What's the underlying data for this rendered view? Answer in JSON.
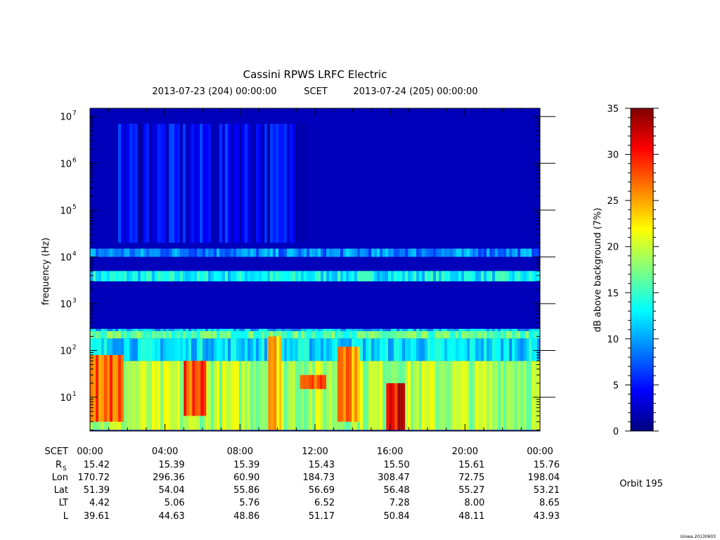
{
  "chart_data": {
    "type": "heatmap",
    "title": "Cassini RPWS LRFC Electric",
    "subtitle": {
      "start": "2013-07-23 (204) 00:00:00",
      "label": "SCET",
      "end": "2013-07-24 (205) 00:00:00"
    },
    "ylabel": "frequency (Hz)",
    "yscale": "log",
    "ylim": [
      1.9,
      15000000
    ],
    "y_ticks": [
      {
        "mantissa": "10",
        "exp": "1",
        "value": 10
      },
      {
        "mantissa": "10",
        "exp": "2",
        "value": 100
      },
      {
        "mantissa": "10",
        "exp": "3",
        "value": 1000
      },
      {
        "mantissa": "10",
        "exp": "4",
        "value": 10000
      },
      {
        "mantissa": "10",
        "exp": "5",
        "value": 100000
      },
      {
        "mantissa": "10",
        "exp": "6",
        "value": 1000000
      },
      {
        "mantissa": "10",
        "exp": "7",
        "value": 10000000
      }
    ],
    "x_hours_range": [
      0,
      24
    ],
    "colorbar": {
      "label": "dB above background (7%)",
      "range": [
        0,
        35
      ],
      "ticks": [
        "0",
        "5",
        "10",
        "15",
        "20",
        "25",
        "30",
        "35"
      ],
      "colors": [
        "#00007f",
        "#0000ff",
        "#007fff",
        "#00ffff",
        "#7fff7f",
        "#ffff00",
        "#ff7f00",
        "#ff0000",
        "#7f0000"
      ]
    },
    "ephemeris": {
      "row_labels": [
        {
          "main": "SCET",
          "sub": ""
        },
        {
          "main": "R",
          "sub": "S"
        },
        {
          "main": "Lon",
          "sub": ""
        },
        {
          "main": "Lat",
          "sub": ""
        },
        {
          "main": "LT",
          "sub": ""
        },
        {
          "main": "L",
          "sub": ""
        }
      ],
      "columns": [
        {
          "hour": 0,
          "values": [
            "00:00",
            "15.42",
            "170.72",
            "51.39",
            "4.42",
            "39.61"
          ]
        },
        {
          "hour": 4,
          "values": [
            "04:00",
            "15.39",
            "296.36",
            "54.04",
            "5.06",
            "44.63"
          ]
        },
        {
          "hour": 8,
          "values": [
            "08:00",
            "15.39",
            "60.90",
            "55.86",
            "5.76",
            "48.86"
          ]
        },
        {
          "hour": 12,
          "values": [
            "12:00",
            "15.43",
            "184.73",
            "56.69",
            "6.52",
            "51.17"
          ]
        },
        {
          "hour": 16,
          "values": [
            "16:00",
            "15.50",
            "308.47",
            "56.48",
            "7.28",
            "50.84"
          ]
        },
        {
          "hour": 20,
          "values": [
            "20:00",
            "15.61",
            "72.75",
            "55.27",
            "8.00",
            "48.11"
          ]
        },
        {
          "hour": 24,
          "values": [
            "00:00",
            "15.76",
            "198.04",
            "53.21",
            "8.65",
            "43.93"
          ]
        }
      ]
    },
    "orbit_label": "Orbit 195",
    "version_label": "Uiowa 20130603",
    "features": [
      {
        "kind": "band",
        "h0": 0,
        "h1": 24,
        "f_lo": 3000,
        "f_hi": 5000,
        "db": 13
      },
      {
        "kind": "band",
        "h0": 0,
        "h1": 24,
        "f_lo": 180,
        "f_hi": 260,
        "db": 16
      },
      {
        "kind": "band",
        "h0": 0,
        "h1": 24,
        "f_lo": 260,
        "f_hi": 290,
        "db": 11
      },
      {
        "kind": "band",
        "h0": 0,
        "h1": 24,
        "f_lo": 10000,
        "f_hi": 15000,
        "db": 9
      },
      {
        "kind": "band",
        "h0": 1.5,
        "h1": 11.5,
        "f_lo": 20000,
        "f_hi": 7000000,
        "db": 4
      },
      {
        "kind": "band",
        "h0": 0,
        "h1": 24,
        "f_lo": 2,
        "f_hi": 60,
        "db": 19
      },
      {
        "kind": "band",
        "h0": 0,
        "h1": 24,
        "f_lo": 60,
        "f_hi": 180,
        "db": 12
      },
      {
        "kind": "band",
        "h0": 0,
        "h1": 1.8,
        "f_lo": 3,
        "f_hi": 80,
        "db": 27
      },
      {
        "kind": "band",
        "h0": 5,
        "h1": 6.2,
        "f_lo": 4,
        "f_hi": 60,
        "db": 28
      },
      {
        "kind": "band",
        "h0": 13.2,
        "h1": 14.4,
        "f_lo": 3,
        "f_hi": 120,
        "db": 26
      },
      {
        "kind": "band",
        "h0": 15.8,
        "h1": 16.8,
        "f_lo": 2,
        "f_hi": 20,
        "db": 31
      },
      {
        "kind": "band",
        "h0": 11.2,
        "h1": 12.6,
        "f_lo": 15,
        "f_hi": 30,
        "db": 27
      },
      {
        "kind": "band",
        "h0": 9.5,
        "h1": 10.2,
        "f_lo": 2,
        "f_hi": 200,
        "db": 24
      }
    ]
  }
}
